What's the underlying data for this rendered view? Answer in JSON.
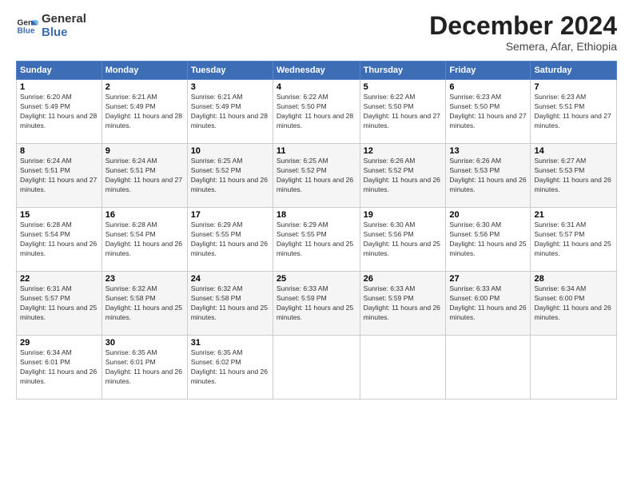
{
  "logo": {
    "line1": "General",
    "line2": "Blue"
  },
  "header": {
    "title": "December 2024",
    "subtitle": "Semera, Afar, Ethiopia"
  },
  "weekdays": [
    "Sunday",
    "Monday",
    "Tuesday",
    "Wednesday",
    "Thursday",
    "Friday",
    "Saturday"
  ],
  "weeks": [
    [
      {
        "day": "1",
        "sunrise": "6:20 AM",
        "sunset": "5:49 PM",
        "daylight": "11 hours and 28 minutes."
      },
      {
        "day": "2",
        "sunrise": "6:21 AM",
        "sunset": "5:49 PM",
        "daylight": "11 hours and 28 minutes."
      },
      {
        "day": "3",
        "sunrise": "6:21 AM",
        "sunset": "5:49 PM",
        "daylight": "11 hours and 28 minutes."
      },
      {
        "day": "4",
        "sunrise": "6:22 AM",
        "sunset": "5:50 PM",
        "daylight": "11 hours and 28 minutes."
      },
      {
        "day": "5",
        "sunrise": "6:22 AM",
        "sunset": "5:50 PM",
        "daylight": "11 hours and 27 minutes."
      },
      {
        "day": "6",
        "sunrise": "6:23 AM",
        "sunset": "5:50 PM",
        "daylight": "11 hours and 27 minutes."
      },
      {
        "day": "7",
        "sunrise": "6:23 AM",
        "sunset": "5:51 PM",
        "daylight": "11 hours and 27 minutes."
      }
    ],
    [
      {
        "day": "8",
        "sunrise": "6:24 AM",
        "sunset": "5:51 PM",
        "daylight": "11 hours and 27 minutes."
      },
      {
        "day": "9",
        "sunrise": "6:24 AM",
        "sunset": "5:51 PM",
        "daylight": "11 hours and 27 minutes."
      },
      {
        "day": "10",
        "sunrise": "6:25 AM",
        "sunset": "5:52 PM",
        "daylight": "11 hours and 26 minutes."
      },
      {
        "day": "11",
        "sunrise": "6:25 AM",
        "sunset": "5:52 PM",
        "daylight": "11 hours and 26 minutes."
      },
      {
        "day": "12",
        "sunrise": "6:26 AM",
        "sunset": "5:52 PM",
        "daylight": "11 hours and 26 minutes."
      },
      {
        "day": "13",
        "sunrise": "6:26 AM",
        "sunset": "5:53 PM",
        "daylight": "11 hours and 26 minutes."
      },
      {
        "day": "14",
        "sunrise": "6:27 AM",
        "sunset": "5:53 PM",
        "daylight": "11 hours and 26 minutes."
      }
    ],
    [
      {
        "day": "15",
        "sunrise": "6:28 AM",
        "sunset": "5:54 PM",
        "daylight": "11 hours and 26 minutes."
      },
      {
        "day": "16",
        "sunrise": "6:28 AM",
        "sunset": "5:54 PM",
        "daylight": "11 hours and 26 minutes."
      },
      {
        "day": "17",
        "sunrise": "6:29 AM",
        "sunset": "5:55 PM",
        "daylight": "11 hours and 26 minutes."
      },
      {
        "day": "18",
        "sunrise": "6:29 AM",
        "sunset": "5:55 PM",
        "daylight": "11 hours and 25 minutes."
      },
      {
        "day": "19",
        "sunrise": "6:30 AM",
        "sunset": "5:56 PM",
        "daylight": "11 hours and 25 minutes."
      },
      {
        "day": "20",
        "sunrise": "6:30 AM",
        "sunset": "5:56 PM",
        "daylight": "11 hours and 25 minutes."
      },
      {
        "day": "21",
        "sunrise": "6:31 AM",
        "sunset": "5:57 PM",
        "daylight": "11 hours and 25 minutes."
      }
    ],
    [
      {
        "day": "22",
        "sunrise": "6:31 AM",
        "sunset": "5:57 PM",
        "daylight": "11 hours and 25 minutes."
      },
      {
        "day": "23",
        "sunrise": "6:32 AM",
        "sunset": "5:58 PM",
        "daylight": "11 hours and 25 minutes."
      },
      {
        "day": "24",
        "sunrise": "6:32 AM",
        "sunset": "5:58 PM",
        "daylight": "11 hours and 25 minutes."
      },
      {
        "day": "25",
        "sunrise": "6:33 AM",
        "sunset": "5:59 PM",
        "daylight": "11 hours and 25 minutes."
      },
      {
        "day": "26",
        "sunrise": "6:33 AM",
        "sunset": "5:59 PM",
        "daylight": "11 hours and 26 minutes."
      },
      {
        "day": "27",
        "sunrise": "6:33 AM",
        "sunset": "6:00 PM",
        "daylight": "11 hours and 26 minutes."
      },
      {
        "day": "28",
        "sunrise": "6:34 AM",
        "sunset": "6:00 PM",
        "daylight": "11 hours and 26 minutes."
      }
    ],
    [
      {
        "day": "29",
        "sunrise": "6:34 AM",
        "sunset": "6:01 PM",
        "daylight": "11 hours and 26 minutes."
      },
      {
        "day": "30",
        "sunrise": "6:35 AM",
        "sunset": "6:01 PM",
        "daylight": "11 hours and 26 minutes."
      },
      {
        "day": "31",
        "sunrise": "6:35 AM",
        "sunset": "6:02 PM",
        "daylight": "11 hours and 26 minutes."
      },
      null,
      null,
      null,
      null
    ]
  ]
}
